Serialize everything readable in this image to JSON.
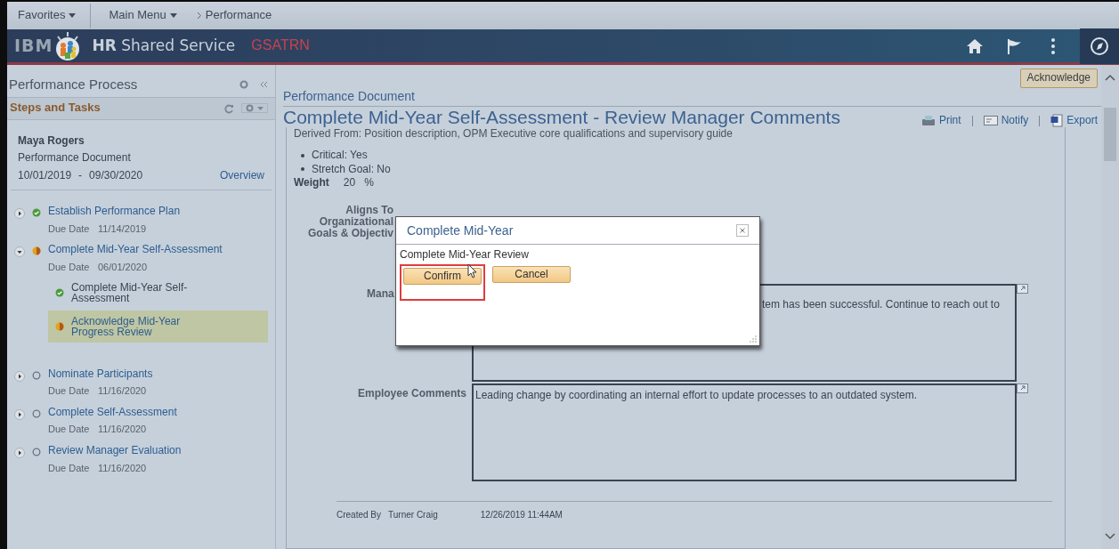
{
  "breadcrumbs": [
    {
      "label": "Favorites",
      "kind": "menu"
    },
    {
      "label": "Main Menu",
      "kind": "menu"
    },
    {
      "label": "Performance",
      "kind": "crumb"
    }
  ],
  "header": {
    "logo": "IBM",
    "app_bold": "HR",
    "app_rest": "Shared Service",
    "environment": "GSATRN"
  },
  "sidebar": {
    "title": "Performance Process",
    "section": "Steps and Tasks",
    "employee": "Maya Rogers",
    "document": "Performance Document",
    "start": "10/01/2019",
    "separator": "-",
    "end": "09/30/2020",
    "overview": "Overview",
    "steps": [
      {
        "title": "Establish Performance Plan",
        "kind": "complete",
        "expanded": false,
        "due_label": "Due Date",
        "due": "11/14/2019"
      },
      {
        "title": "Complete Mid-Year Self-Assessment",
        "kind": "in_progress",
        "expanded": true,
        "due_label": "Due Date",
        "due": "06/01/2020",
        "children": [
          {
            "title": "Complete Mid-Year Self-Assessment",
            "kind": "complete",
            "selected": false
          },
          {
            "title": "Acknowledge Mid-Year Progress Review",
            "kind": "in_progress",
            "selected": true
          }
        ]
      },
      {
        "title": "Nominate Participants",
        "kind": "not_started",
        "expanded": false,
        "due_label": "Due Date",
        "due": "11/16/2020"
      },
      {
        "title": "Complete Self-Assessment",
        "kind": "not_started",
        "expanded": false,
        "due_label": "Due Date",
        "due": "11/16/2020"
      },
      {
        "title": "Review Manager Evaluation",
        "kind": "not_started",
        "expanded": false,
        "due_label": "Due Date",
        "due": "11/16/2020"
      }
    ]
  },
  "document": {
    "heading": "Performance Document",
    "acknowledge": "Acknowledge",
    "title": "Complete Mid-Year Self-Assessment - Review Manager Comments",
    "actions": [
      {
        "label": "Print",
        "kind": "print"
      },
      {
        "label": "Notify",
        "kind": "notify"
      },
      {
        "label": "Export",
        "kind": "export"
      }
    ],
    "derived": "Derived From: Position description, OPM Executive core qualifications and supervisory guide",
    "bullets": [
      "Critical: Yes",
      "Stretch Goal: No"
    ],
    "weight_label": "Weight",
    "weight": "20",
    "weight_unit": "%",
    "aligns_label": [
      "Aligns To",
      "Organizational",
      "Goals & Objectiv"
    ],
    "comments": [
      {
        "label": "Mana",
        "text": "tem has been successful. Continue to reach out to",
        "behind_dialog": true
      },
      {
        "label": "Employee Comments",
        "text": "Leading change by coordinating an internal effort to update processes to an outdated system.",
        "behind_dialog": false
      }
    ],
    "created_label": "Created By",
    "created_by": "Turner Craig",
    "created_at": "12/26/2019 11:44AM"
  },
  "dialog": {
    "title": "Complete Mid-Year",
    "message": "Complete Mid-Year Review",
    "buttons": [
      {
        "label": "Confirm",
        "highlighted": true
      },
      {
        "label": "Cancel",
        "highlighted": false
      }
    ]
  }
}
